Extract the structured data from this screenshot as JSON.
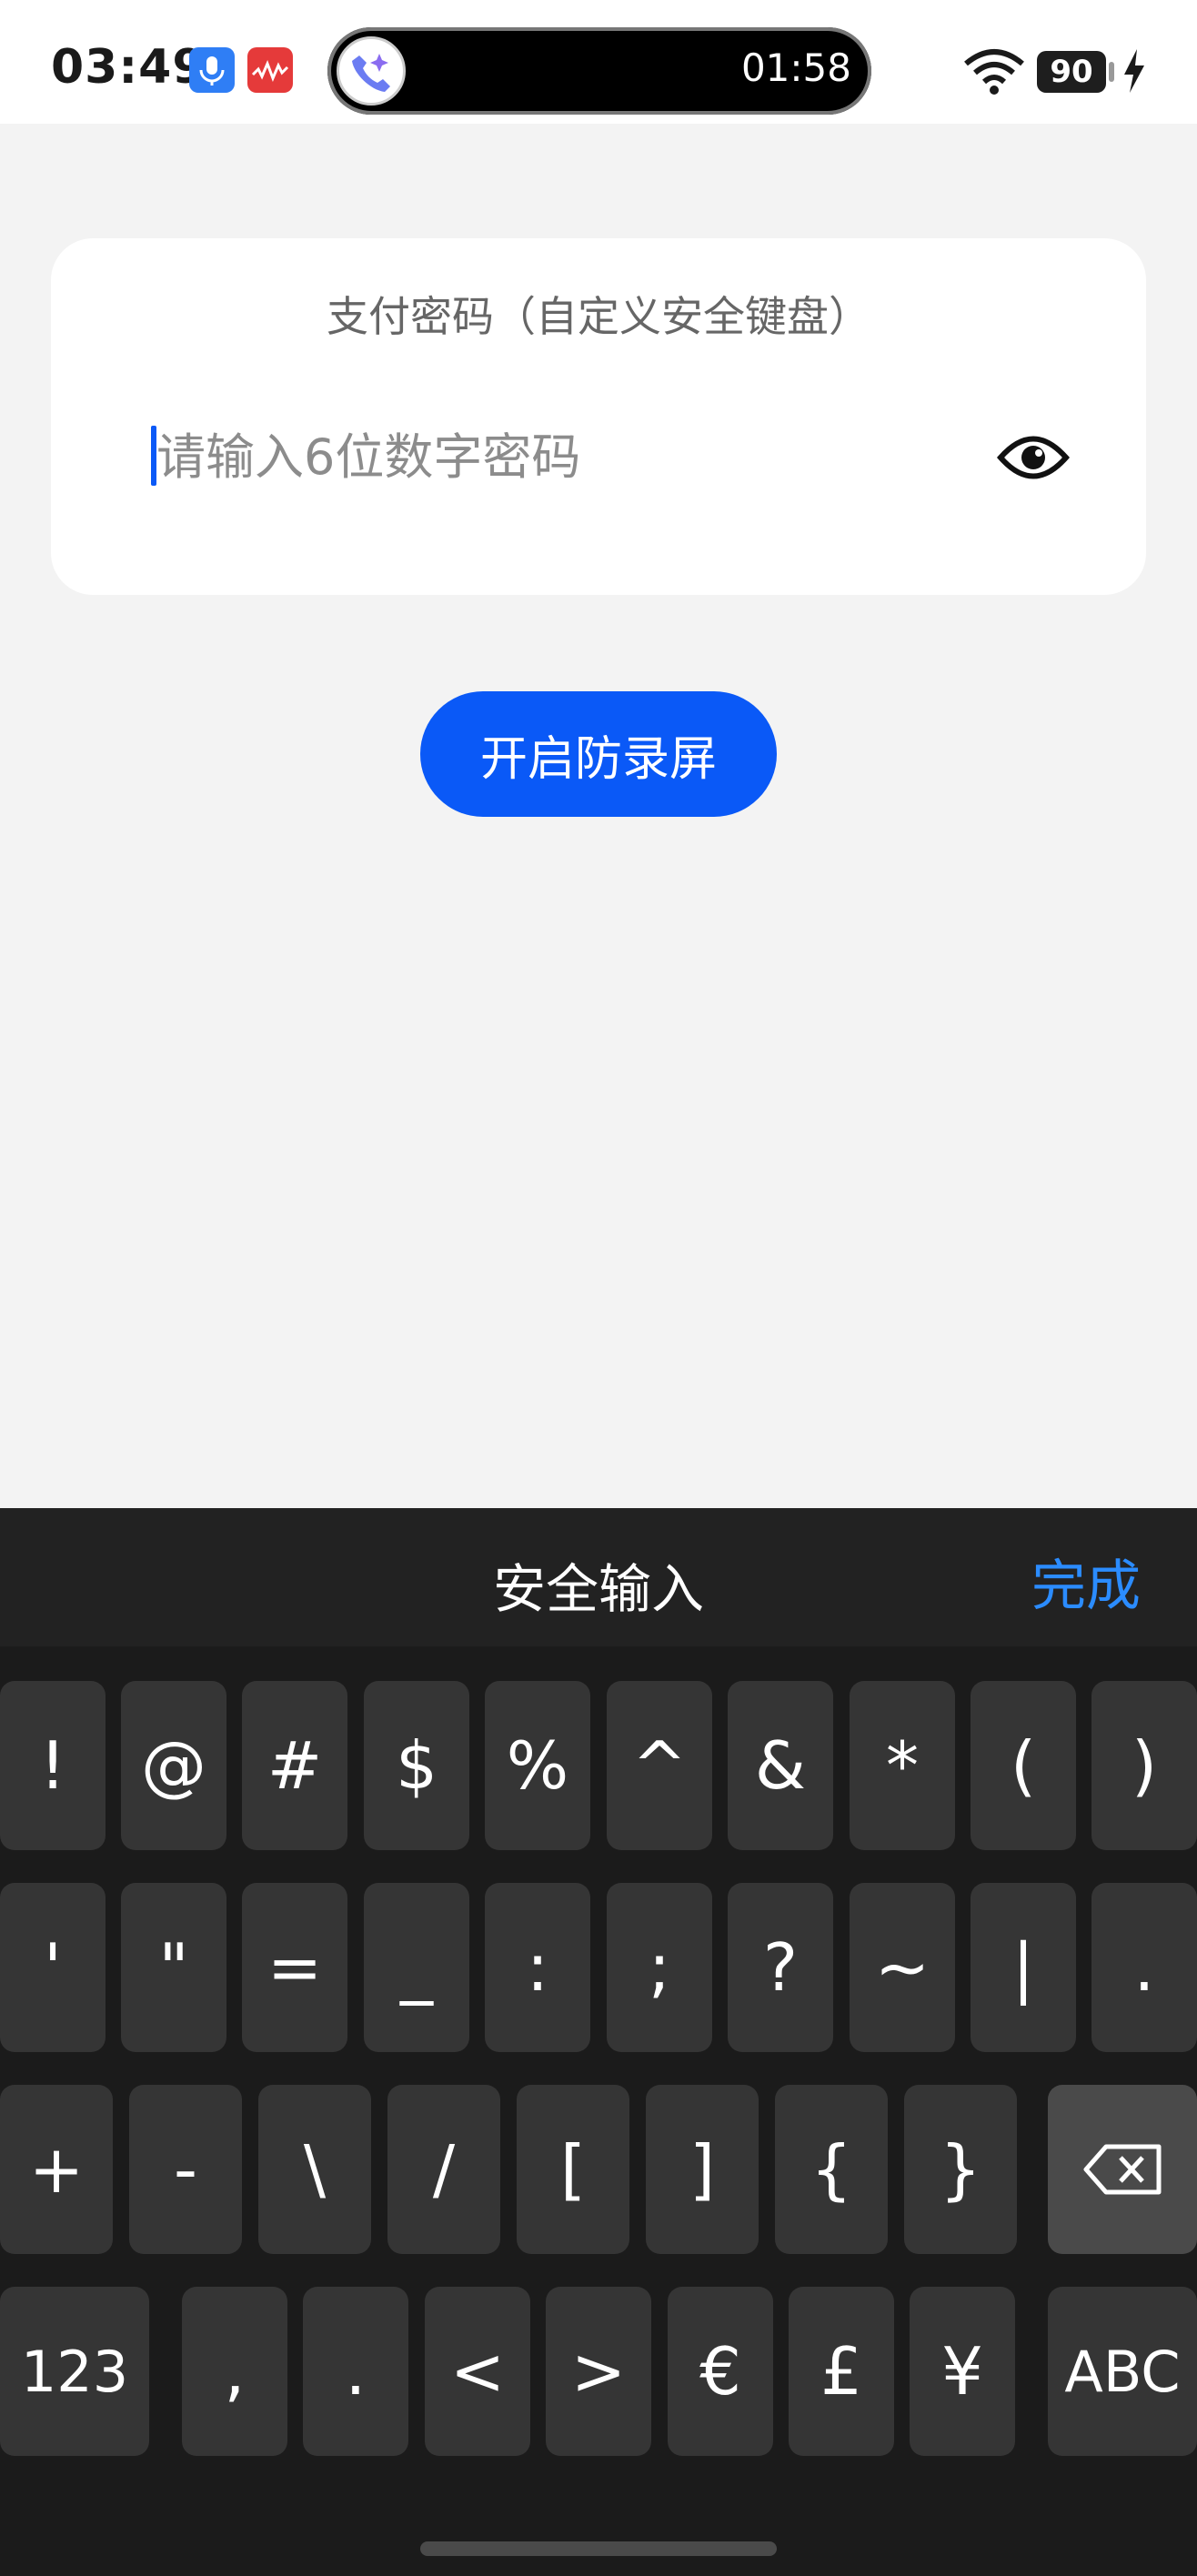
{
  "status_bar": {
    "time": "03:49",
    "call_timer": "01:58",
    "battery": "90"
  },
  "card": {
    "title": "支付密码（自定义安全键盘）",
    "placeholder": "请输入6位数字密码"
  },
  "record_button": "开启防录屏",
  "keyboard": {
    "title": "安全输入",
    "done_label": "完成",
    "row1": [
      "!",
      "@",
      "#",
      "$",
      "%",
      "^",
      "&",
      "*",
      "(",
      ")"
    ],
    "row2": [
      "'",
      "\"",
      "=",
      "_",
      ":",
      ";",
      "?",
      "~",
      "|",
      "."
    ],
    "row3": [
      "+",
      "-",
      "\\",
      "/",
      "[",
      "]",
      "{",
      "}"
    ],
    "row4_left": "123",
    "row4": [
      ",",
      ".",
      "<",
      ">",
      "€",
      "£",
      "¥"
    ],
    "row4_right": "ABC"
  },
  "colors": {
    "accent": "#0a59f7",
    "done": "#2b8cff",
    "keyboard_bg": "#1b1b1b",
    "key_bg": "#353535"
  }
}
